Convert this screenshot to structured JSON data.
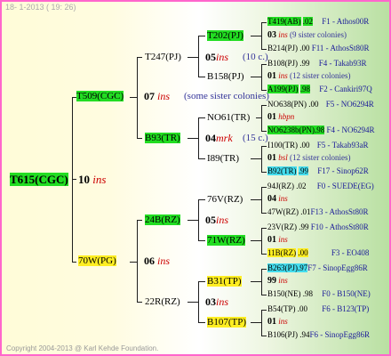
{
  "header": "18- 1-2013 ( 19: 26)",
  "footer": "Copyright 2004-2013 @ Karl Kehde Foundation.",
  "root": {
    "id": "T615(CGC)",
    "year": "10",
    "ins": "ins"
  },
  "gen1": [
    {
      "id": "T509(CGC)",
      "year": "07",
      "ins": "ins",
      "note": "(some sister colonies)"
    },
    {
      "id": "70W(PG)",
      "year": "06",
      "ins": "ins"
    }
  ],
  "gen2": [
    {
      "id": "T247(PJ)",
      "year": "05",
      "ins": "ins",
      "note": "(10 c.)"
    },
    {
      "id": "B93(TR)",
      "year": "04",
      "ins": "mrk",
      "note": "(15 c.)"
    },
    {
      "id": "24B(RZ)",
      "year": "05",
      "ins": "ins"
    },
    {
      "id": "22R(RZ)",
      "year": "03",
      "ins": "ins"
    }
  ],
  "gen3": [
    {
      "id": "T202(PJ)",
      "year": "03",
      "ins": "ins",
      "note": "(9 sister colonies)"
    },
    {
      "id": "B158(PJ)",
      "year": "01",
      "ins": "ins",
      "note": "(12 sister colonies)"
    },
    {
      "id": "NO61(TR)",
      "year": "01",
      "ins": "hbpn"
    },
    {
      "id": "I89(TR)",
      "year": "01",
      "ins": "bsl",
      "note": "(12 sister colonies)"
    },
    {
      "id": "76V(RZ)",
      "year": "04",
      "ins": "ins"
    },
    {
      "id": "71W(RZ)",
      "year": "01",
      "ins": "ins"
    },
    {
      "id": "B31(TP)",
      "year": "99",
      "ins": "ins"
    },
    {
      "id": "B107(TP)",
      "year": "01",
      "ins": "ins"
    }
  ],
  "gen4": [
    {
      "id": "T419(AB)",
      "num": ".02",
      "name": "F1 - Athos00R"
    },
    {
      "id": "B214(PJ)",
      "num": ".00",
      "name": "F11 - AthosSt80R"
    },
    {
      "id": "B108(PJ)",
      "num": ".99",
      "name": "F4 - Takab93R"
    },
    {
      "id": "A199(PJ)",
      "num": ".98",
      "name": "F2 - Cankiri97Q"
    },
    {
      "id": "NO638(PN)",
      "num": ".00",
      "name": "F5 - NO6294R"
    },
    {
      "id": "NO6238b(PN)",
      "num": ".98",
      "name": "F4 - NO6294R"
    },
    {
      "id": "I100(TR)",
      "num": ".00",
      "name": "F5 - Takab93aR"
    },
    {
      "id": "B92(TR)",
      "num": ".99",
      "name": "F17 - Sinop62R"
    },
    {
      "id": "94J(RZ)",
      "num": ".02",
      "name": "F0 - SUEDE(EG)"
    },
    {
      "id": "47W(RZ)",
      "num": ".01",
      "name": "F13 - AthosSt80R"
    },
    {
      "id": "23V(RZ)",
      "num": ".99",
      "name": "F10 - AthosSt80R"
    },
    {
      "id": "11B(RZ)",
      "num": ".00",
      "name": "F3 - EO408"
    },
    {
      "id": "B263(PJ)",
      "num": ".97",
      "name": "F7 - SinopEgg86R"
    },
    {
      "id": "B150(NE)",
      "num": ".98",
      "name": "F0 - B150(NE)"
    },
    {
      "id": "B54(TP)",
      "num": ".00",
      "name": "F6 - B123(TP)"
    },
    {
      "id": "B106(PJ)",
      "num": ".94",
      "name": "F6 - SinopEgg86R"
    }
  ]
}
